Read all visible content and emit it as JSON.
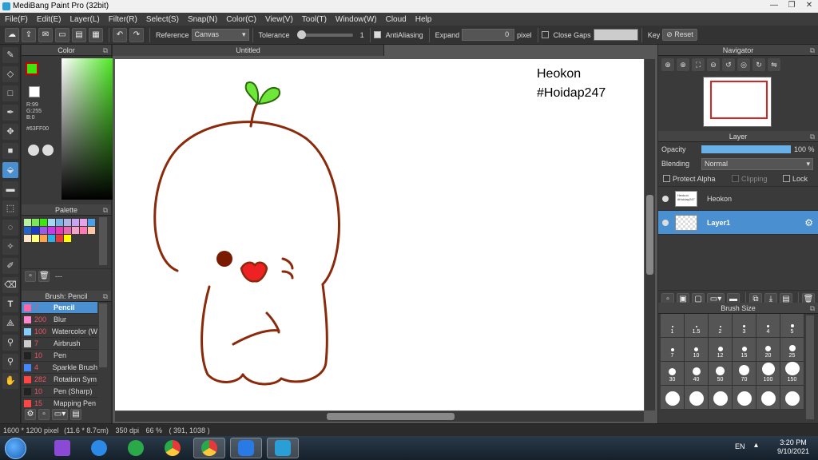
{
  "window": {
    "title": "MediBang Paint Pro (32bit)",
    "minimize": "—",
    "maximize": "❐",
    "close": "✕"
  },
  "menu": [
    "File(F)",
    "Edit(E)",
    "Layer(L)",
    "Filter(R)",
    "Select(S)",
    "Snap(N)",
    "Color(C)",
    "View(V)",
    "Tool(T)",
    "Window(W)",
    "Cloud",
    "Help"
  ],
  "toolbar": {
    "reference_label": "Reference",
    "reference_value": "Canvas",
    "tolerance_label": "Tolerance",
    "tolerance_value": "1",
    "antialiasing_label": "AntiAliasing",
    "expand_label": "Expand",
    "expand_value": "0",
    "expand_unit": "pixel",
    "close_gaps_label": "Close Gaps",
    "key_label": "Key",
    "reset_label": "Reset"
  },
  "color_panel": {
    "title": "Color",
    "r": "R:99",
    "g": "G:255",
    "b": "B:0",
    "hex": "#63FF00",
    "fg_color": "#3ee610"
  },
  "palette_panel": {
    "title": "Palette",
    "swatches": [
      "#b6f2a0",
      "#7ae65a",
      "#3ee610",
      "#a4d8f2",
      "#7ab2e6",
      "#b2b2e6",
      "#c8a4f2",
      "#e6a4e6",
      "#4aa0e6",
      "#2266cc",
      "#1a3acc",
      "#9a5ae6",
      "#c83ae6",
      "#e63ab2",
      "#e66ab2",
      "#f2a4c8",
      "#ff7ab2",
      "#ffc8a4",
      "#ffe6c8",
      "#ffff7a",
      "#ffa44a",
      "#2ab2e6",
      "#e63a3a",
      "#ffff00"
    ],
    "extra": "---"
  },
  "brush_panel": {
    "title": "Brush: Pencil",
    "brushes": [
      {
        "size": "7",
        "name": "Pencil",
        "color": "#ff66aa"
      },
      {
        "size": "200",
        "name": "Blur",
        "color": "#ff88cc"
      },
      {
        "size": "100",
        "name": "Watercolor (W",
        "color": "#88ccff"
      },
      {
        "size": "7",
        "name": "Airbrush",
        "color": "#cccccc"
      },
      {
        "size": "10",
        "name": "Pen",
        "color": "#222222"
      },
      {
        "size": "4",
        "name": "Sparkle Brush",
        "color": "#4488ff"
      },
      {
        "size": "282",
        "name": "Rotation Sym",
        "color": "#ff4444"
      },
      {
        "size": "10",
        "name": "Pen (Sharp)",
        "color": "#222222"
      },
      {
        "size": "15",
        "name": "Mapping Pen",
        "color": "#ff4444"
      }
    ]
  },
  "canvas": {
    "tab_title": "Untitled",
    "text_line1": "Heokon",
    "text_line2": "#Hoidap247"
  },
  "navigator": {
    "title": "Navigator"
  },
  "layer_panel": {
    "title": "Layer",
    "opacity_label": "Opacity",
    "opacity_value": "100 %",
    "opacity_fraction": 1.0,
    "blending_label": "Blending",
    "blending_value": "Normal",
    "protect_alpha": "Protect Alpha",
    "clipping": "Clipping",
    "lock": "Lock",
    "layers": [
      {
        "name": "Heokon",
        "thumb_text": "Heokon #Hoidap247",
        "selected": false
      },
      {
        "name": "Layer1",
        "selected": true
      }
    ]
  },
  "brush_size_panel": {
    "title": "Brush Size",
    "sizes": [
      "1",
      "1.5",
      "2",
      "3",
      "4",
      "5",
      "7",
      "10",
      "12",
      "15",
      "20",
      "25",
      "30",
      "40",
      "50",
      "70",
      "100",
      "150",
      "",
      "",
      "",
      "",
      "",
      ""
    ]
  },
  "status": {
    "dimensions": "1600 * 1200 pixel",
    "physical": "(11.6 * 8.7cm)",
    "dpi": "350 dpi",
    "zoom": "66 %",
    "cursor": "( 391, 1038 )"
  },
  "taskbar": {
    "language": "EN",
    "time": "3:20 PM",
    "date": "9/10/2021"
  }
}
